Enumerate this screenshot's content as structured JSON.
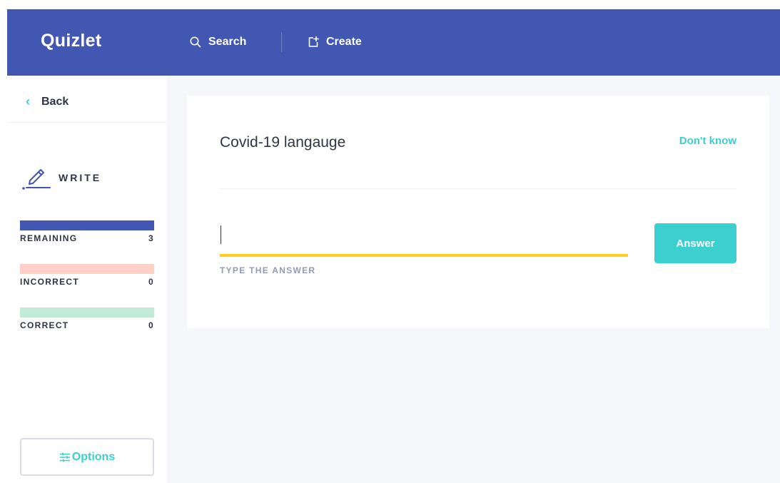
{
  "header": {
    "logo": "Quizlet",
    "search_label": "Search",
    "create_label": "Create"
  },
  "sidebar": {
    "back_label": "Back",
    "mode_label": "WRITE",
    "stats": [
      {
        "label": "REMAINING",
        "count": "3",
        "color": "#4257b2"
      },
      {
        "label": "INCORRECT",
        "count": "0",
        "color": "#ffd0c8"
      },
      {
        "label": "CORRECT",
        "count": "0",
        "color": "#c1ead8"
      }
    ],
    "options_label": "Options"
  },
  "question": {
    "prompt": "Covid-19 langauge",
    "dont_know_label": "Don't know",
    "input_value": "",
    "input_hint": "TYPE THE ANSWER",
    "answer_button": "Answer"
  },
  "colors": {
    "brand": "#4257b2",
    "accent": "#3ccfcf",
    "input_underline": "#ffcd1f"
  }
}
